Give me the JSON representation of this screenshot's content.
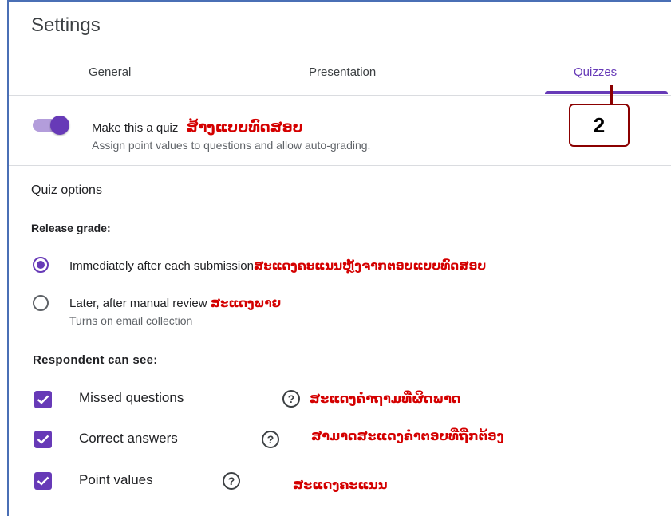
{
  "header": {
    "title": "Settings"
  },
  "tabs": [
    {
      "label": "General"
    },
    {
      "label": "Presentation"
    },
    {
      "label": "Quizzes",
      "active": true
    }
  ],
  "callout": {
    "number": "2"
  },
  "quiz_toggle": {
    "label": "Make this a quiz",
    "annotation": "ສ້າງແບບທົດສອບ",
    "description": "Assign point values to questions and allow auto-grading.",
    "on": true
  },
  "quiz_options": {
    "title": "Quiz options",
    "release_grade": {
      "title": "Release grade:",
      "options": [
        {
          "label": "Immediately after each submission",
          "annotation": "ສະແດງຄະແນນຫຼັງຈາກຕອບແບບທົດສອບ",
          "selected": true
        },
        {
          "label": "Later, after manual review",
          "annotation": "ສະແດງພາຍ",
          "sub": "Turns on email collection",
          "selected": false
        }
      ]
    },
    "respondent": {
      "title": "Respondent can see:",
      "items": [
        {
          "label": "Missed questions",
          "annotation": "ສະແດງຄໍາຖາມທີ່ຜິດພາດ",
          "checked": true
        },
        {
          "label": "Correct answers",
          "annotation": "ສາມາດສະແດງຄໍາຕອບທີ່ຖືກຕ້ອງ",
          "checked": true
        },
        {
          "label": "Point values",
          "annotation": "ສະແດງຄະແນນ",
          "checked": true
        }
      ]
    }
  },
  "colors": {
    "accent": "#673ab7",
    "annotation": "#d40000",
    "frame": "#4a6fb5"
  }
}
